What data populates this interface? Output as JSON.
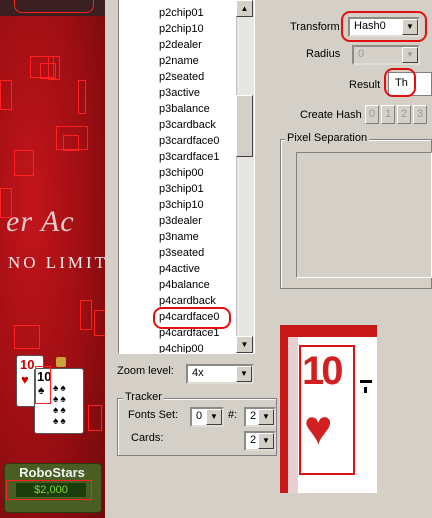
{
  "table": {
    "wordmark": "er Ac",
    "limit": "NO LIMIT",
    "card_rank": "10",
    "player_name": "RoboStars",
    "player_cash": "$2,000"
  },
  "list": {
    "items": [
      "p2chip01",
      "p2chip10",
      "p2dealer",
      "p2name",
      "p2seated",
      "p3active",
      "p3balance",
      "p3cardback",
      "p3cardface0",
      "p3cardface1",
      "p3chip00",
      "p3chip01",
      "p3chip10",
      "p3dealer",
      "p3name",
      "p3seated",
      "p4active",
      "p4balance",
      "p4cardback",
      "p4cardface0",
      "p4cardface1",
      "p4chip00"
    ],
    "selected_index": 19
  },
  "zoom": {
    "label": "Zoom level:",
    "value": "4x"
  },
  "tracker": {
    "title": "Tracker",
    "fonts_label": "Fonts Set:",
    "fonts_value": "0",
    "hash_label": "#:",
    "hash_value": "2",
    "cards_label": "Cards:",
    "cards_value": "2"
  },
  "transform": {
    "label": "Transform",
    "value": "Hash0"
  },
  "radius": {
    "label": "Radius",
    "value": "0"
  },
  "result": {
    "label": "Result",
    "value": "Th"
  },
  "create_hash": {
    "label": "Create Hash",
    "buttons": [
      "0",
      "1",
      "2",
      "3"
    ]
  },
  "pixel_separation": {
    "title": "Pixel Separation"
  },
  "preview": {
    "rank": "10"
  },
  "colors": {
    "accent_red": "#e01010",
    "felt_red": "#b51218",
    "panel": "#d4d0c8"
  }
}
